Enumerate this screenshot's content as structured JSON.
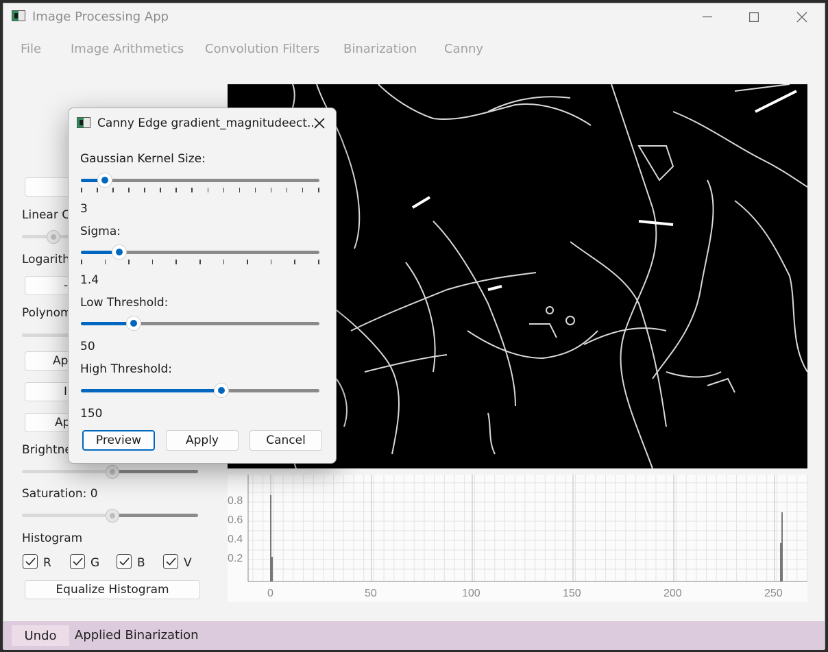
{
  "window": {
    "title": "Image Processing App"
  },
  "menu": [
    "File",
    "Image Arithmetics",
    "Convolution Filters",
    "Binarization",
    "Canny"
  ],
  "left_panel": {
    "linear_label": "Linear Co",
    "log_label": "Logarithi",
    "log_button": "-",
    "poly_label": "Polynom",
    "btn_apply1": "App",
    "btn_in": "In",
    "btn_apply2": "Ap",
    "brightness_label": "Brightnes",
    "saturation_label": "Saturation: 0",
    "histogram_label": "Histogram",
    "checkboxes": [
      "R",
      "G",
      "B",
      "V"
    ],
    "equalize_button": "Equalize Histogram"
  },
  "histogram": {
    "x_ticks": [
      "0",
      "50",
      "100",
      "150",
      "200",
      "250"
    ],
    "y_ticks": [
      "0.8",
      "0.6",
      "0.4",
      "0.2"
    ]
  },
  "dialog": {
    "title": "Canny Edge gradient_magnitudeect...",
    "kernel_label": "Gaussian Kernel Size:",
    "kernel_value": "3",
    "kernel_fraction": 0.1,
    "sigma_label": "Sigma:",
    "sigma_value": "1.4",
    "sigma_fraction": 0.16,
    "low_label": "Low Threshold:",
    "low_value": "50",
    "low_fraction": 0.22,
    "high_label": "High Threshold:",
    "high_value": "150",
    "high_fraction": 0.59,
    "preview": "Preview",
    "apply": "Apply",
    "cancel": "Cancel"
  },
  "status": {
    "undo": "Undo",
    "message": "Applied Binarization"
  }
}
